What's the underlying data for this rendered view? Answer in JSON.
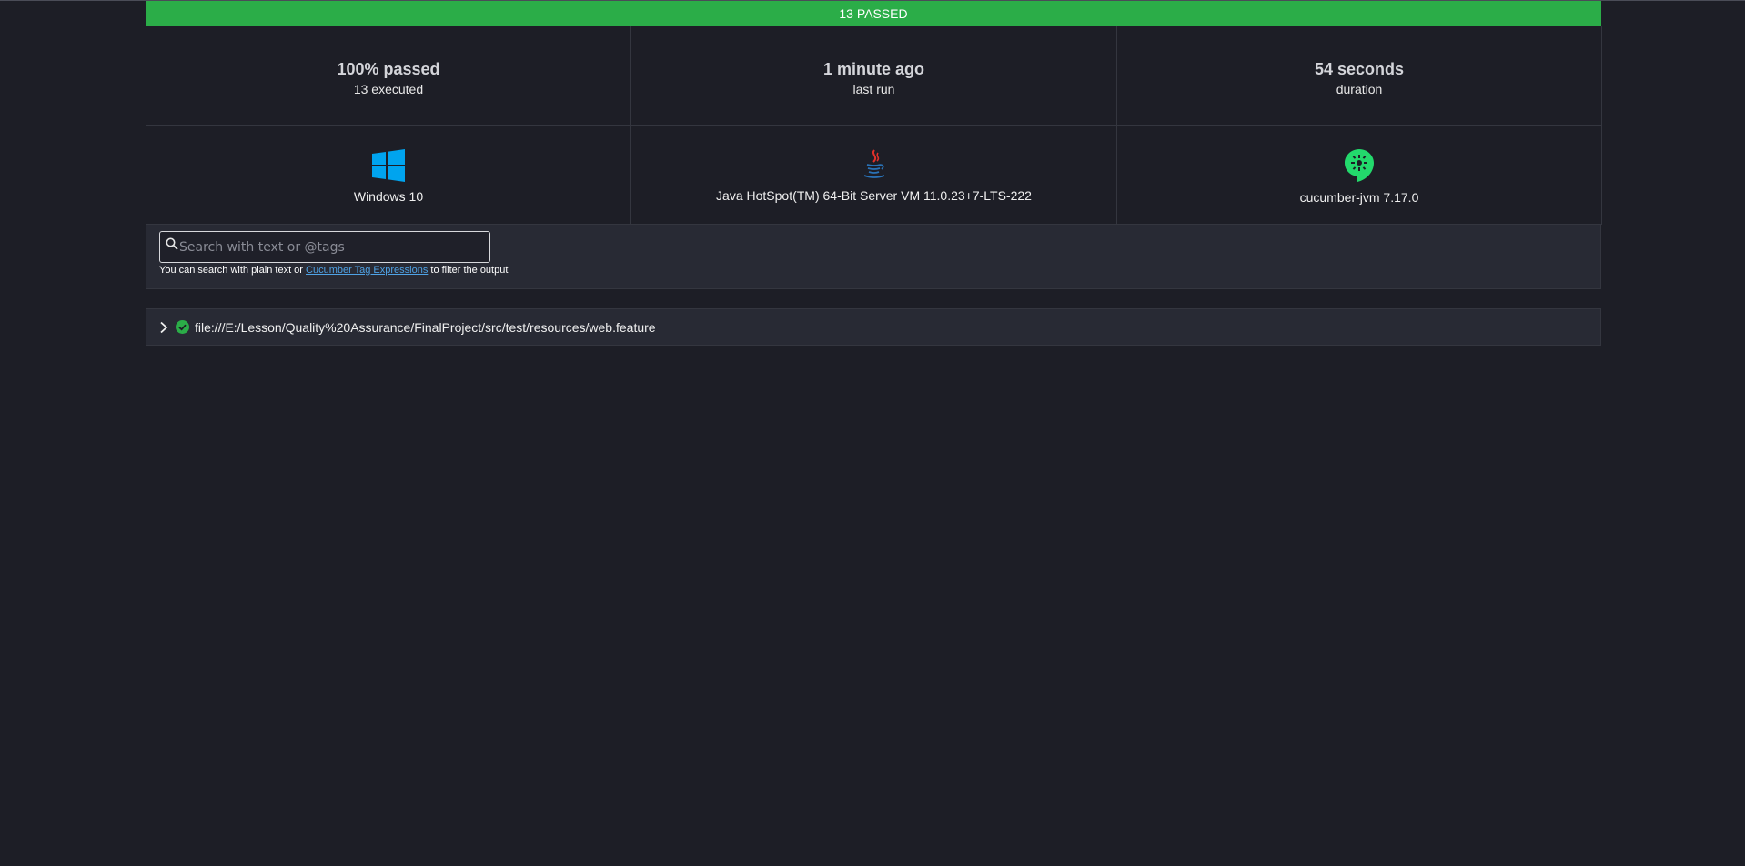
{
  "summary": {
    "status_banner": "13 PASSED",
    "passed_percent": "100% passed",
    "executed": "13 executed",
    "last_run": "1 minute ago",
    "last_run_label": "last run",
    "duration": "54 seconds",
    "duration_label": "duration"
  },
  "environment": {
    "os": "Windows 10",
    "runtime": "Java HotSpot(TM) 64-Bit Server VM 11.0.23+7-LTS-222",
    "implementation": "cucumber-jvm 7.17.0",
    "icons": [
      "windows-icon",
      "java-icon",
      "cucumber-icon"
    ]
  },
  "search": {
    "placeholder": "Search with text or @tags",
    "value": "",
    "help_prefix": "You can search with plain text or ",
    "help_link": "Cucumber Tag Expressions",
    "help_suffix": " to filter the output"
  },
  "features": [
    {
      "path": "file:///E:/Lesson/Quality%20Assurance/FinalProject/src/test/resources/web.feature",
      "status": "passed"
    }
  ],
  "colors": {
    "passed": "#2bad48",
    "background": "#1d1e26",
    "panel": "#282a34",
    "link": "#4fa3e6",
    "windows_blue": "#00a4ef",
    "cucumber_green": "#23d96c"
  }
}
